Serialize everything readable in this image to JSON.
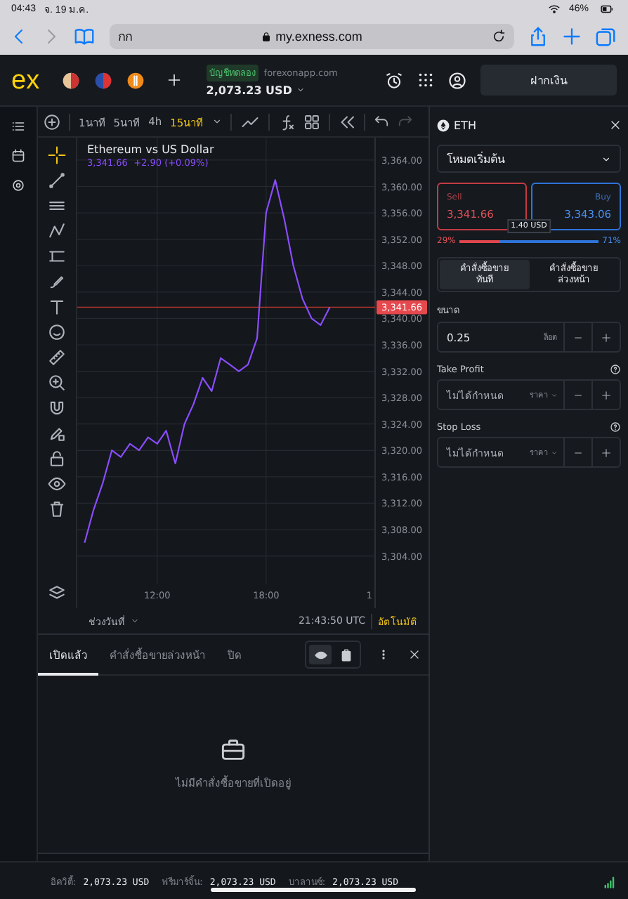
{
  "status_bar": {
    "time": "04:43",
    "date": "จ. 19 ม.ค.",
    "battery": "46%"
  },
  "browser": {
    "text_size": "กก",
    "url": "my.exness.com"
  },
  "header": {
    "logo": "ex",
    "account_type": "บัญชีทดลอง",
    "server": "forexonapp.com",
    "balance": "2,073.23 USD",
    "deposit": "ฝากเงิน"
  },
  "chart_toolbar": {
    "timeframes": [
      {
        "label": "1นาที",
        "selected": false
      },
      {
        "label": "5นาที",
        "selected": false
      },
      {
        "label": "4h",
        "selected": false
      },
      {
        "label": "15นาที",
        "selected": true
      }
    ]
  },
  "chart": {
    "title": "Ethereum vs US Dollar",
    "quote": "3,341.66  +2.90 (+0.09%)",
    "price_tag": "3,341.66",
    "edge_time_label": "1",
    "date_range": "ช่วงวันที่",
    "time": "21:43:50 UTC",
    "scale_mode": "อัตโนมัติ",
    "chart_data": {
      "type": "line",
      "x": [
        8,
        8.5,
        9,
        9.5,
        10,
        10.5,
        11,
        11.5,
        12,
        12.5,
        13,
        13.5,
        14,
        14.5,
        15,
        15.5,
        16,
        16.5,
        17,
        17.5,
        18,
        18.5,
        19,
        19.5,
        20,
        20.5,
        21,
        21.5
      ],
      "series": [
        {
          "color": "#8a4dff",
          "values": [
            3306,
            3311,
            3315,
            3320,
            3319,
            3321,
            3320,
            3322,
            3321,
            3323,
            3318,
            3324,
            3327,
            3331,
            3329,
            3334,
            3333,
            3332,
            3333,
            3337,
            3356,
            3361,
            3355,
            3348,
            3343,
            3340,
            3339,
            3341.7
          ]
        }
      ],
      "xlim": [
        7.6,
        24
      ],
      "ylim": [
        3299.7,
        3367.4
      ],
      "grid": true,
      "ref_lines": [
        {
          "axis": "y",
          "value": 3341.7,
          "color": "#c0392b"
        }
      ],
      "xticks": [
        {
          "value": 12,
          "label": "12:00"
        },
        {
          "value": 18,
          "label": "18:00"
        }
      ],
      "yticks": [
        {
          "value": 3364,
          "label": "3,364.00"
        },
        {
          "value": 3360,
          "label": "3,360.00"
        },
        {
          "value": 3356,
          "label": "3,356.00"
        },
        {
          "value": 3352,
          "label": "3,352.00"
        },
        {
          "value": 3348,
          "label": "3,348.00"
        },
        {
          "value": 3344,
          "label": "3,344.00"
        },
        {
          "value": 3340,
          "label": "3,340.00"
        },
        {
          "value": 3336,
          "label": "3,336.00"
        },
        {
          "value": 3332,
          "label": "3,332.00"
        },
        {
          "value": 3328,
          "label": "3,328.00"
        },
        {
          "value": 3324,
          "label": "3,324.00"
        },
        {
          "value": 3320,
          "label": "3,320.00"
        },
        {
          "value": 3316,
          "label": "3,316.00"
        },
        {
          "value": 3312,
          "label": "3,312.00"
        },
        {
          "value": 3308,
          "label": "3,308.00"
        },
        {
          "value": 3304,
          "label": "3,304.00"
        }
      ]
    }
  },
  "order_panel": {
    "symbol": "ETH",
    "mode": "โหมดเริ่มต้น",
    "sell": {
      "label": "Sell",
      "price": "3,341.66"
    },
    "buy": {
      "label": "Buy",
      "price": "3,343.06"
    },
    "spread": "1.40 USD",
    "sentiment": {
      "sell_percent": "29%",
      "buy_percent": "71%",
      "level": 0.29
    },
    "order_types": [
      {
        "label": "คำสั่งซื้อขายทันที",
        "selected": true
      },
      {
        "label": "คำสั่งซื้อขายล่วงหน้า",
        "selected": false
      }
    ],
    "volume": {
      "label": "ขนาด",
      "value": "0.25",
      "unit": "ล็อต"
    },
    "take_profit": {
      "label": "Take Profit",
      "placeholder": "ไม่ได้กำหนด",
      "unit": "ราคา"
    },
    "stop_loss": {
      "label": "Stop Loss",
      "placeholder": "ไม่ได้กำหนด",
      "unit": "ราคา"
    }
  },
  "orders": {
    "tabs": [
      {
        "label": "เปิดแล้ว",
        "selected": true
      },
      {
        "label": "คำสั่งซื้อขายล่วงหน้า",
        "selected": false
      },
      {
        "label": "ปิด",
        "selected": false
      }
    ],
    "view_toggles": [
      {
        "kind": "eye",
        "selected": true
      },
      {
        "kind": "clipboard",
        "selected": false
      }
    ],
    "empty_message": "ไม่มีคำสั่งซื้อขายที่เปิดอยู่"
  },
  "footer": [
    {
      "label": "อิควิตี้:",
      "value": "2,073.23 USD"
    },
    {
      "label": "ฟรีมาร์จิ้น:",
      "value": "2,073.23 USD"
    },
    {
      "label": "บาลานซ์:",
      "value": "2,073.23 USD"
    }
  ]
}
